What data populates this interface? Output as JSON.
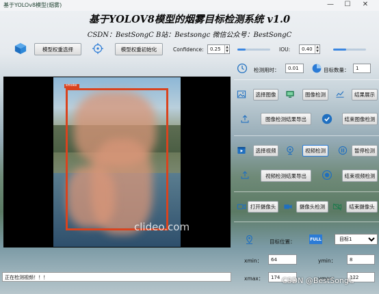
{
  "window": {
    "title": "基于YOLOv8模型(烟雾)",
    "minimize": "—",
    "maximize": "☐",
    "close": "✕"
  },
  "header": {
    "title": "基于YOLOV8模型的烟雾目标检测系统 v1.0",
    "subtitle": "CSDN：BestSongC   B站：Bestsongc   微信公众号：BestSongC"
  },
  "toolbar": {
    "model_select": "模型权重选择",
    "model_init": "模型权重初始化",
    "confidence_label": "Confidence:",
    "confidence_value": "0.25",
    "confidence_level": 0.25,
    "iou_label": "IOU:",
    "iou_value": "0.40",
    "iou_level": 0.4
  },
  "stats": {
    "time_label": "检测用时：",
    "time_value": "0.01",
    "count_label": "目标数量：",
    "count_value": "1"
  },
  "image_row": {
    "select": "选择图像",
    "detect": "图像检测",
    "show": "结果展示"
  },
  "image_export": {
    "export": "图像检测结果导出",
    "end": "结束图像检测"
  },
  "video_row": {
    "select": "选择视频",
    "detect": "视频检测",
    "pause": "暂停检测"
  },
  "video_export": {
    "export": "视频检测结果导出",
    "end": "结束视频检测"
  },
  "camera_row": {
    "open": "打开摄像头",
    "detect": "摄像头检测",
    "close": "结束摄像头"
  },
  "target": {
    "position_label": "目标位置：",
    "selected": "目标1",
    "options": [
      "目标1"
    ],
    "all_badge": "FULL",
    "xmin_label": "xmin：",
    "xmin_value": "64",
    "ymin_label": "ymin：",
    "ymin_value": "8",
    "xmax_label": "xmax：",
    "xmax_value": "174",
    "ymax_label": "ymax：",
    "ymax_value": "122"
  },
  "video": {
    "watermark": "clideo.com",
    "box_label": "smoke"
  },
  "status": {
    "text": "正在检测视频！！！"
  },
  "watermark": {
    "text": "CSDN @BestSongC"
  },
  "colors": {
    "bbox": "#d9431e",
    "accent": "#2b7bd6"
  }
}
